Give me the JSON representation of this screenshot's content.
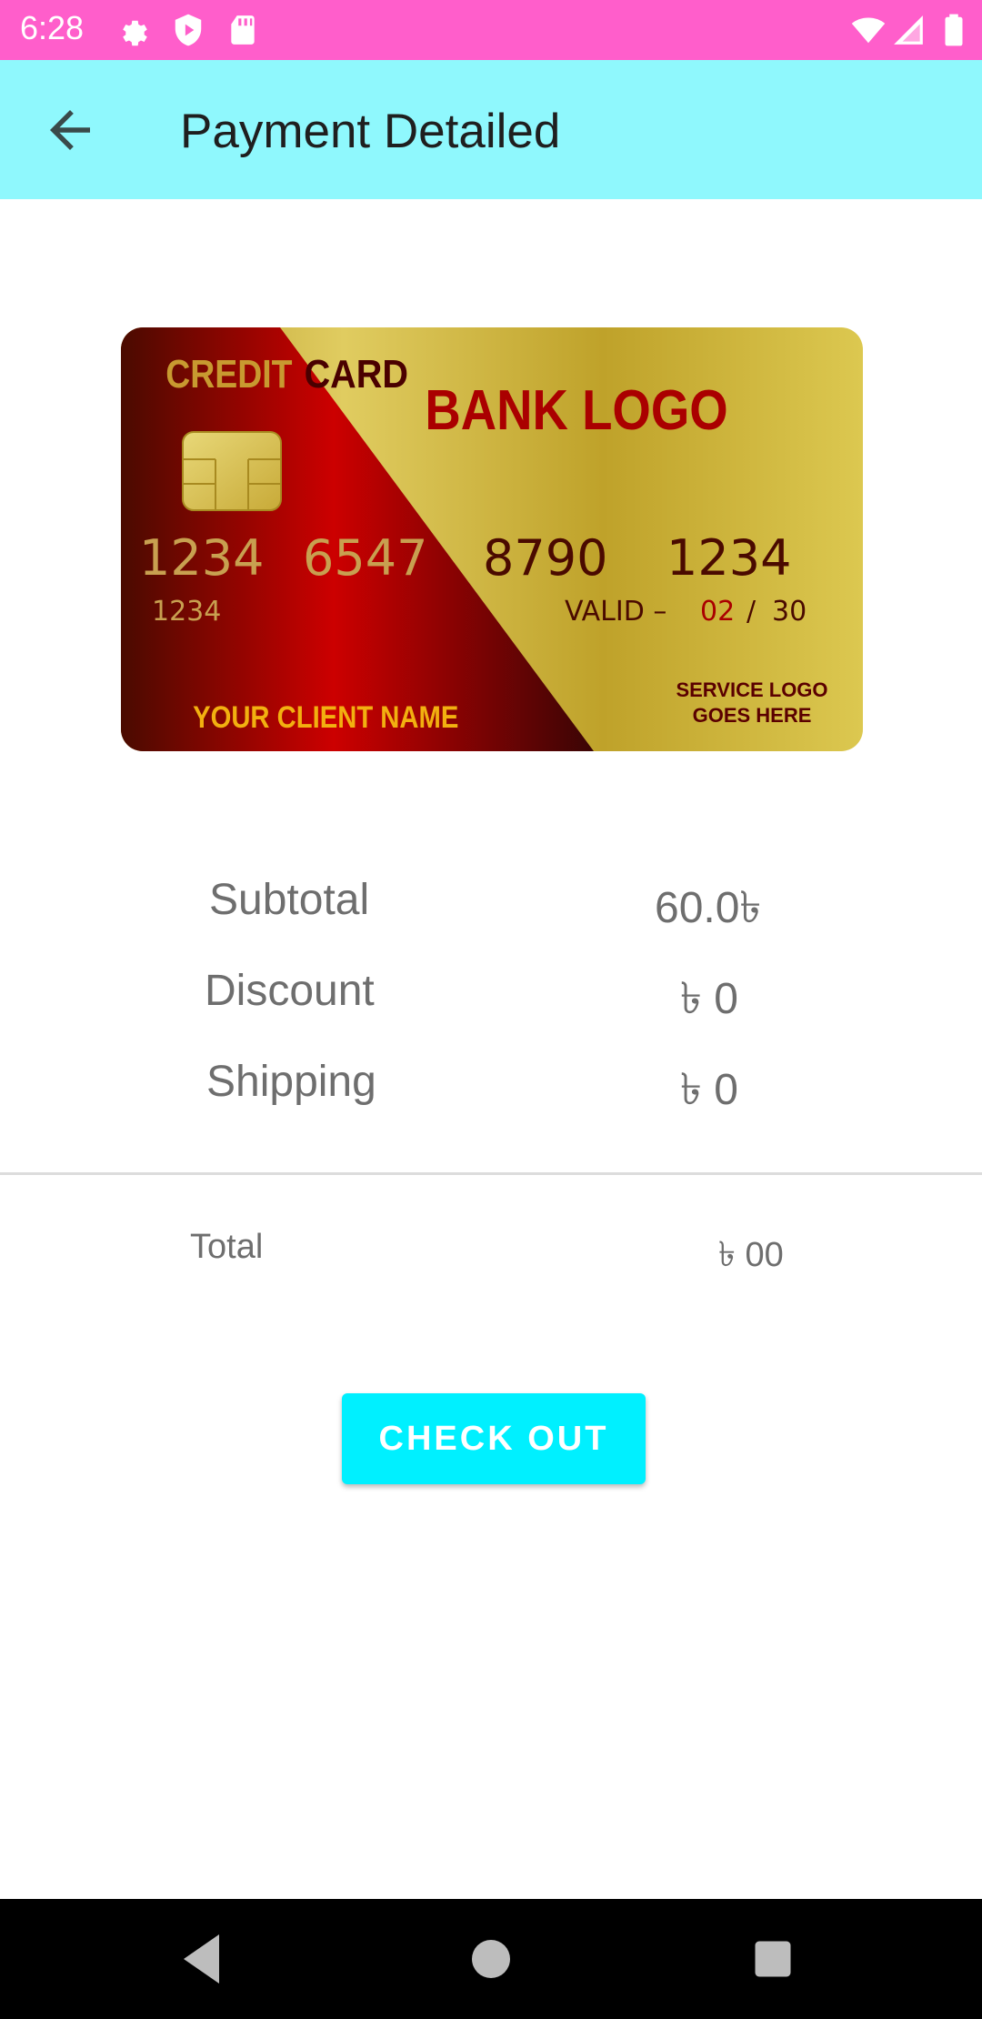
{
  "status_bar": {
    "time": "6:28",
    "icons": [
      "gear-icon",
      "shield-play-icon",
      "sd-card-icon",
      "wifi-icon",
      "signal-icon",
      "battery-icon"
    ]
  },
  "app_bar": {
    "title": "Payment Detailed",
    "back_icon": "arrow-left-icon"
  },
  "card": {
    "label_credit": "CREDIT",
    "label_card": "CARD",
    "bank_logo": "BANK LOGO",
    "number_group_1": "1234",
    "number_group_2": "6547",
    "number_group_3": "8790",
    "number_group_4": "1234",
    "small_number": "1234",
    "valid_label": "VALID –",
    "valid_month": "02",
    "valid_sep": "/",
    "valid_year": "30",
    "client_name": "YOUR CLIENT NAME",
    "service_logo_line1": "SERVICE LOGO",
    "service_logo_line2": "GOES HERE"
  },
  "summary": {
    "subtotal_label": "Subtotal",
    "subtotal_value": "60.0৳",
    "discount_label": "Discount",
    "discount_value": "৳ 0",
    "shipping_label": "Shipping",
    "shipping_value": "৳ 0",
    "total_label": "Total",
    "total_value": "৳ 00"
  },
  "checkout_button": {
    "label": "CHECK OUT"
  },
  "nav_bar": {
    "icons": [
      "back-triangle-icon",
      "home-circle-icon",
      "recents-square-icon"
    ]
  },
  "colors": {
    "status_bar": "#ff5ecb",
    "app_bar": "#8ff8fd",
    "button": "#00f0ff",
    "card_red": "#cc0000",
    "card_gold": "#d8c24a"
  }
}
